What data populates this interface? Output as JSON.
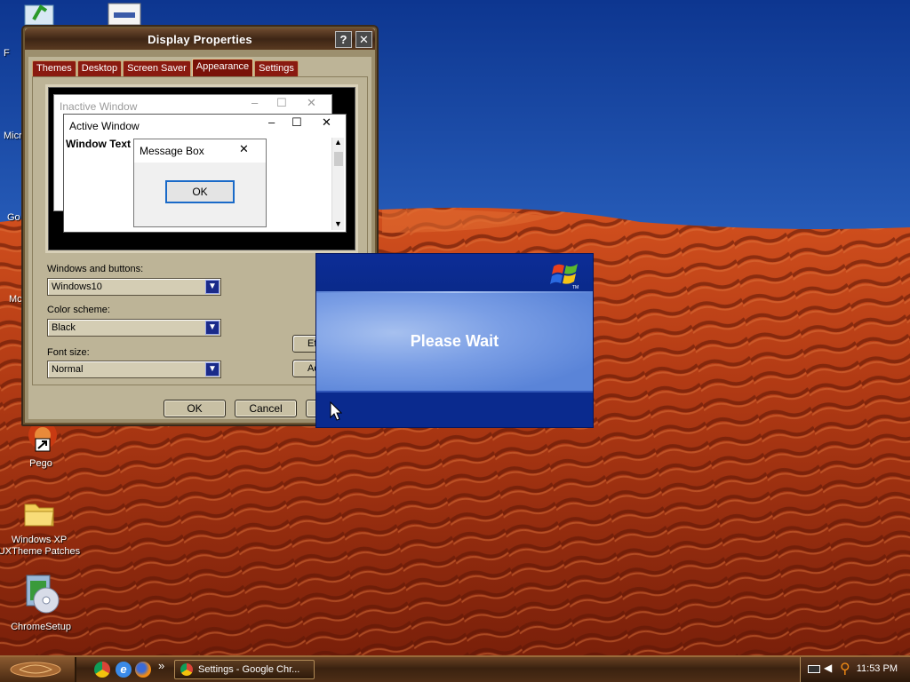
{
  "desktop": {
    "icons": [
      {
        "id": "pego",
        "label": "Pego"
      },
      {
        "id": "uxtheme",
        "label": "Windows XP UXTheme Patches"
      },
      {
        "id": "chromesetup",
        "label": "ChromeSetup"
      }
    ],
    "cut_labels": [
      "F",
      "Micr",
      "Go",
      "Mc"
    ]
  },
  "display_properties": {
    "title": "Display Properties",
    "help_button": "?",
    "close_button": "✕",
    "tabs": [
      {
        "label": "Themes",
        "active": false
      },
      {
        "label": "Desktop",
        "active": false
      },
      {
        "label": "Screen Saver",
        "active": false
      },
      {
        "label": "Appearance",
        "active": true
      },
      {
        "label": "Settings",
        "active": false
      }
    ],
    "preview": {
      "inactive_window_title": "Inactive Window",
      "active_window_title": "Active Window",
      "window_text": "Window Text",
      "message_box_title": "Message Box",
      "message_box_ok": "OK"
    },
    "windows_and_buttons": {
      "label": "Windows and buttons:",
      "value": "Windows10"
    },
    "color_scheme": {
      "label": "Color scheme:",
      "value": "Black"
    },
    "font_size": {
      "label": "Font size:",
      "value": "Normal"
    },
    "effects_button": "Effe",
    "advanced_button": "Adv",
    "ok_button": "OK",
    "cancel_button": "Cancel"
  },
  "please_wait": {
    "text": "Please Wait",
    "logo_tm": "TM"
  },
  "taskbar": {
    "overflow_chevron": "»",
    "task_button": "Settings - Google Chr...",
    "clock": "11:53 PM",
    "quick_launch": [
      "chrome-icon",
      "ie-icon",
      "firefox-icon"
    ]
  },
  "colors": {
    "accent_tab": "#8a1a10",
    "wait_blue": "#0a2a8e",
    "sand": "#c8461e",
    "sky": "#2d6cd2"
  }
}
